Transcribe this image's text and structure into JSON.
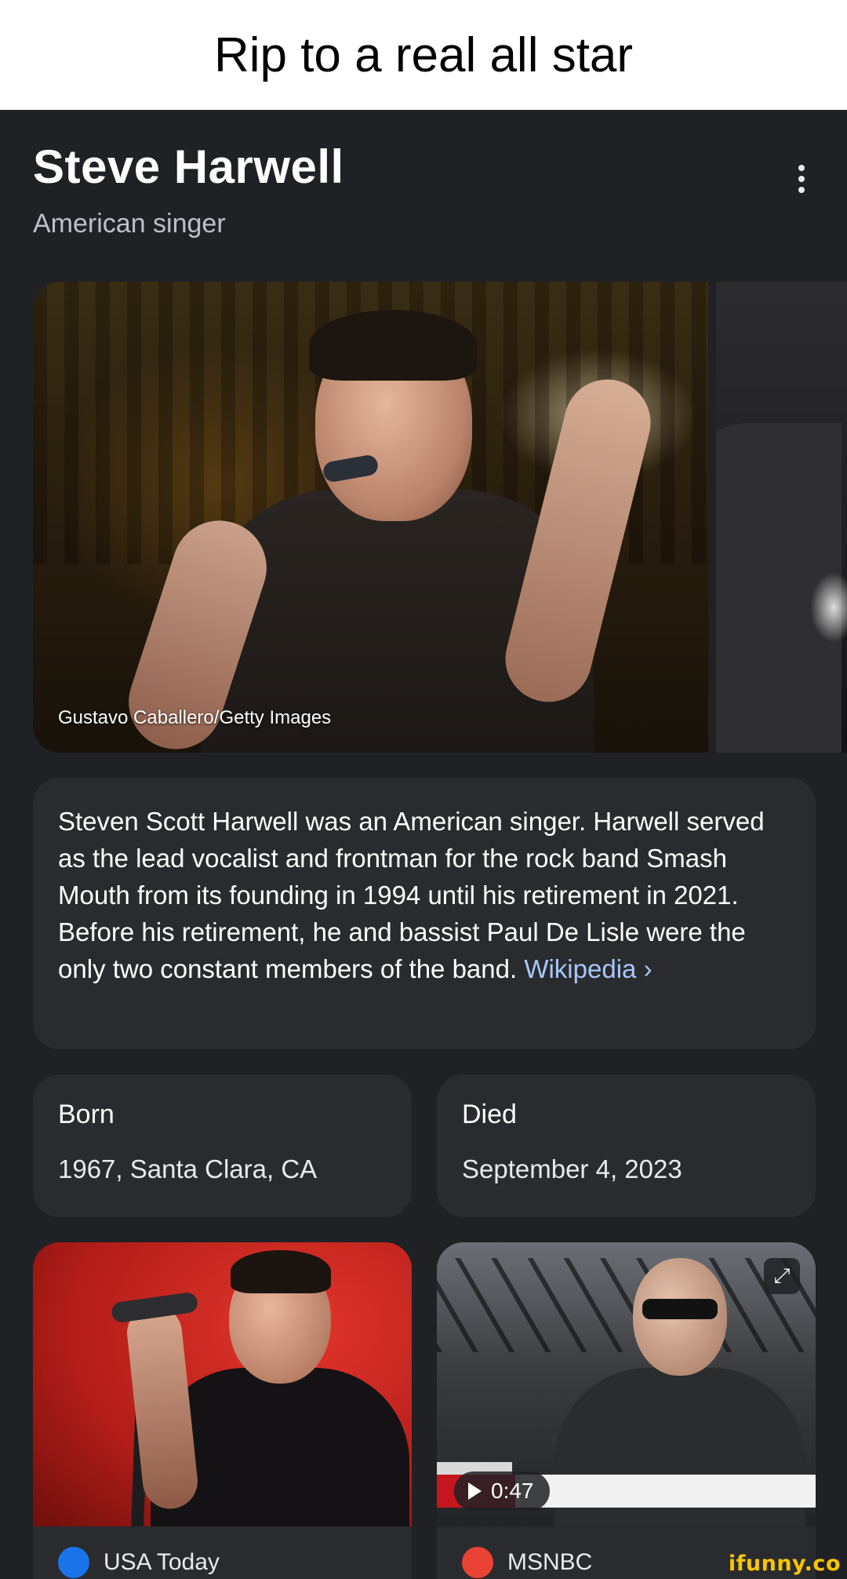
{
  "meme": {
    "caption": "Rip to a real all star"
  },
  "knowledge_panel": {
    "title": "Steve Harwell",
    "subtitle": "American singer",
    "more_icon": "more-vert-icon",
    "hero_image": {
      "credit": "Gustavo Caballero/Getty Images"
    },
    "description": {
      "text": "Steven Scott Harwell was an American singer. Harwell served as the lead vocalist and frontman for the rock band Smash Mouth from its founding in 1994 until his retirement in 2021. Before his retirement, he and bassist Paul De Lisle were the only two constant members of the band.",
      "link_label": "Wikipedia",
      "link_chevron": "›"
    },
    "facts": [
      {
        "label": "Born",
        "value": "1967, Santa Clara, CA"
      },
      {
        "label": "Died",
        "value": "September 4, 2023"
      }
    ],
    "media": [
      {
        "source": "USA Today",
        "logo_color": "#1a73e8"
      },
      {
        "source": "MSNBC",
        "duration": "0:47",
        "logo_color": "#e94235",
        "expand_icon": "expand-icon"
      }
    ]
  },
  "watermark": "ifunny.co"
}
